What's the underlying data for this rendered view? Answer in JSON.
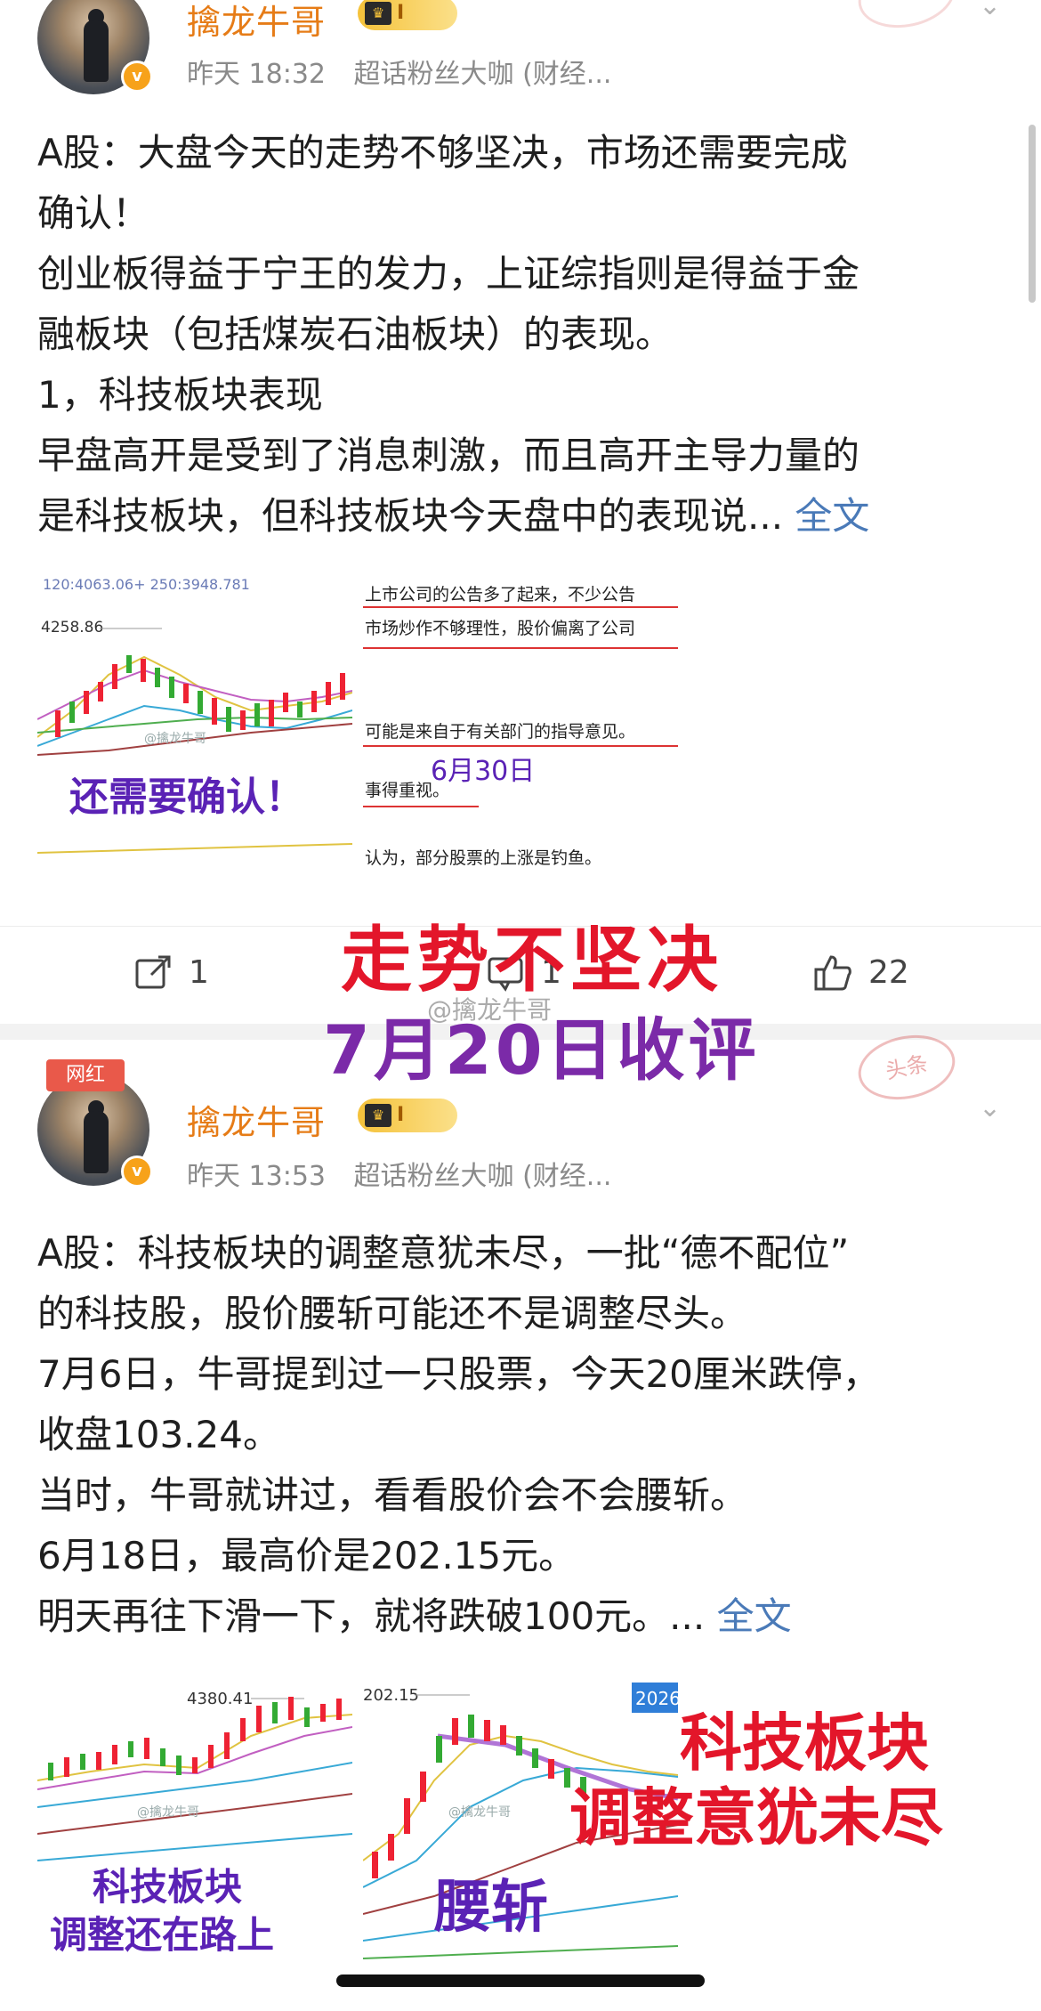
{
  "posts": [
    {
      "username": "擒龙牛哥",
      "level": "I",
      "time": "昨天 18:32",
      "source": "超话粉丝大咖 (财经...",
      "lines": [
        "A股：大盘今天的走势不够坚决，市场还需要完成",
        "确认！",
        "创业板得益于宁王的发力，上证综指则是得益于金",
        "融板块（包括煤炭石油板块）的表现。",
        "1，科技板块表现",
        "早盘高开是受到了消息刺激，而且高开主导力量的",
        "是科技板块，但科技板块今天盘中的表现说..."
      ],
      "more": "全文",
      "image1": {
        "top_text": "120:4063.06+ 250:3948.781",
        "price_label": "4258.86",
        "watermark": "@擒龙牛哥",
        "caption": "还需要确认！"
      },
      "image2": {
        "lines": [
          "上市公司的公告多了起来，不少公告",
          "市场炒作不够理性，股价偏离了公司",
          "可能是来自于有关部门的指导意见。",
          "事得重视。",
          "认为，部分股票的上涨是钓鱼。"
        ],
        "date": "6月30日"
      },
      "share_count": "1",
      "comment_count": "1",
      "like_count": "22"
    },
    {
      "tag": "网红",
      "username": "擒龙牛哥",
      "level": "I",
      "time": "昨天 13:53",
      "source": "超话粉丝大咖 (财经...",
      "stamp": "头条",
      "lines": [
        "A股：科技板块的调整意犹未尽，一批“德不配位”",
        "的科技股，股价腰斩可能还不是调整尽头。",
        "7月6日，牛哥提到过一只股票，今天20厘米跌停，",
        "收盘103.24。",
        "当时，牛哥就讲过，看看股价会不会腰斩。",
        "6月18日，最高价是202.15元。",
        "明天再往下滑一下，就将跌破100元。..."
      ],
      "more": "全文",
      "image1": {
        "price_label": "4380.41",
        "watermark": "@擒龙牛哥",
        "caption_line1": "科技板块",
        "caption_line2": "调整还在路上"
      },
      "image2": {
        "price_label": "202.15",
        "corner": "2026",
        "watermark": "@擒龙牛哥",
        "caption": "腰斩"
      }
    }
  ],
  "overlay": {
    "title_red": "走势不坚决",
    "title_purple": "7月20日收评",
    "watermark": "@擒龙牛哥",
    "right_red_line1": "科技板块",
    "right_red_line2": "调整意犹未尽"
  },
  "colors": {
    "username": "#e67c17",
    "link": "#4a7ab8",
    "overlay_red": "#e3162a",
    "overlay_purple": "#7b2aa8"
  }
}
